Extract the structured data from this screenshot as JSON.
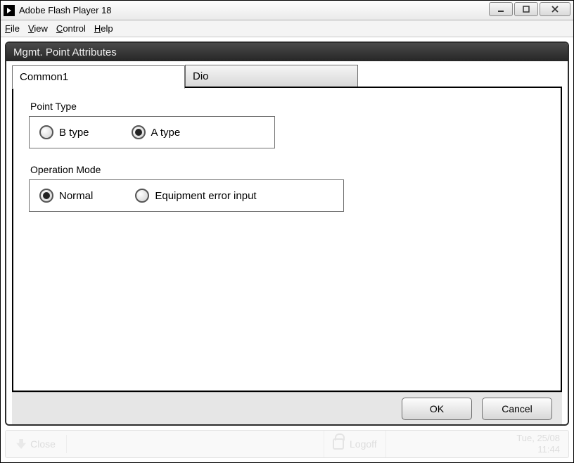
{
  "window": {
    "title": "Adobe Flash Player 18"
  },
  "menu": {
    "file": "File",
    "view": "View",
    "control": "Control",
    "help": "Help"
  },
  "panel": {
    "title": "Mgmt. Point Attributes",
    "tabs": [
      {
        "label": "Common1",
        "active": true
      },
      {
        "label": "Dio",
        "active": false
      }
    ]
  },
  "point_type": {
    "label": "Point Type",
    "options": [
      {
        "label": "B type",
        "selected": false
      },
      {
        "label": "A type",
        "selected": true
      }
    ]
  },
  "operation_mode": {
    "label": "Operation Mode",
    "options": [
      {
        "label": "Normal",
        "selected": true
      },
      {
        "label": "Equipment error input",
        "selected": false
      }
    ]
  },
  "buttons": {
    "ok": "OK",
    "cancel": "Cancel"
  },
  "ghost": {
    "close": "Close",
    "logoff": "Logoff",
    "date": "Tue, 25/08",
    "time": "11:44"
  }
}
